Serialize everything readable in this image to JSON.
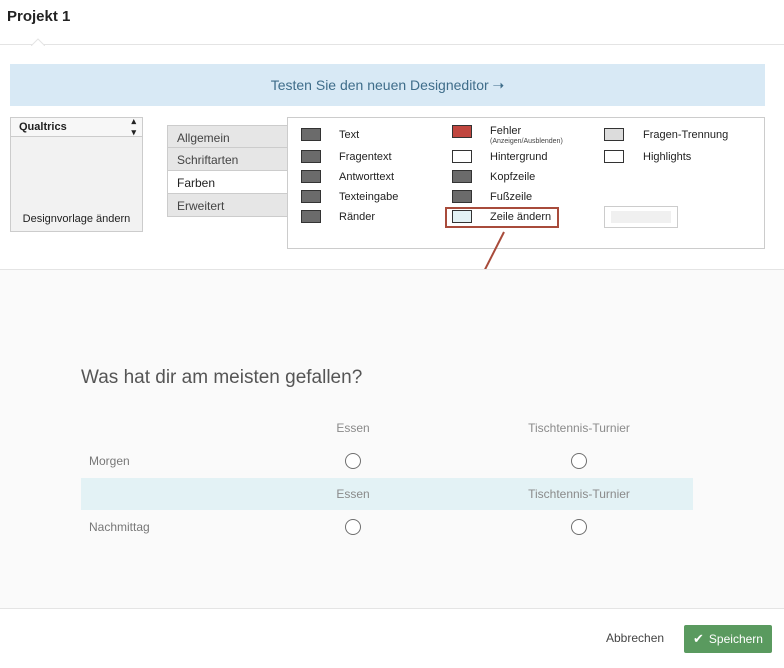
{
  "header": {
    "title": "Projekt 1"
  },
  "banner": {
    "text": "Testen Sie den neuen Designeditor ➝"
  },
  "theme": {
    "selected": "Qualtrics",
    "change_label": "Designvorlage ändern"
  },
  "side_tabs": [
    "Allgemein",
    "Schriftarten",
    "Farben",
    "Erweitert"
  ],
  "colors": {
    "col1": [
      "Text",
      "Fragentext",
      "Antworttext",
      "Texteingabe",
      "Ränder"
    ],
    "col2": [
      "Fehler",
      "Hintergrund",
      "Kopfzeile",
      "Fußzeile",
      "Zeile ändern"
    ],
    "col2_sub": "(Anzeigen/Ausblenden)",
    "col3": [
      "Fragen-Trennung",
      "Highlights"
    ],
    "swatches": {
      "dark": "#6b6b6b",
      "error": "#c0463f",
      "white": "#ffffff",
      "alt_row": "#e3f2f5",
      "separator": "#dcdcdc"
    }
  },
  "preview": {
    "question": "Was hat dir am meisten gefallen?",
    "columns": [
      "Essen",
      "Tischtennis-Turnier"
    ],
    "rows": [
      "Morgen",
      "Nachmittag"
    ]
  },
  "footer": {
    "cancel_label": "Abbrechen",
    "save_label": "Speichern"
  },
  "accent": {
    "save_button": "#5a9a5f",
    "highlight_border": "#a84b3b"
  }
}
